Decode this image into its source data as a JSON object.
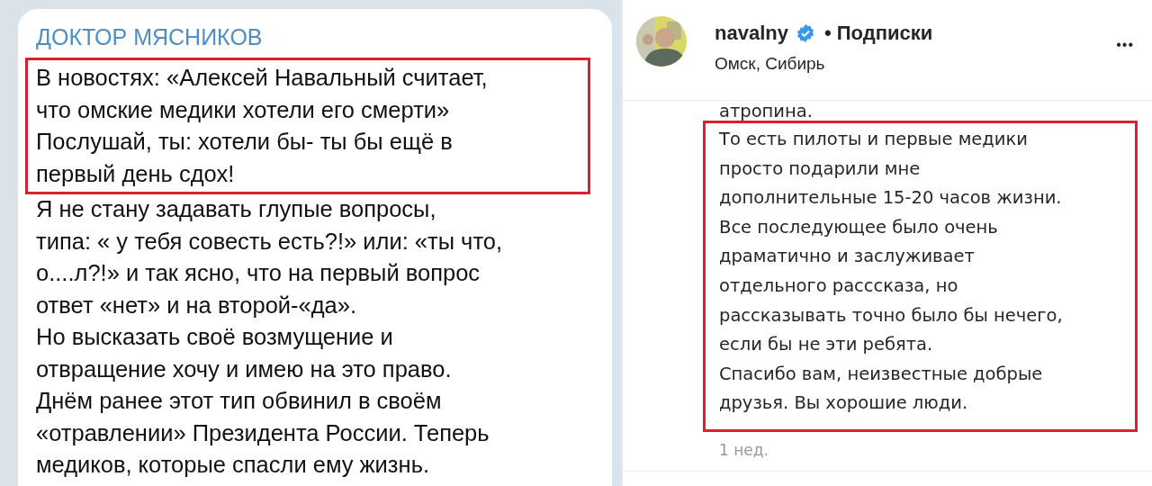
{
  "telegram_post": {
    "channel": "ДОКТОР МЯСНИКОВ",
    "highlighted_lines": [
      "В новостях: «Алексей Навальный считает,",
      "что омские медики хотели его смерти»",
      "Послушай, ты: хотели бы- ты бы ещё в",
      "первый день сдох!"
    ],
    "lines": [
      "Я не стану задавать глупые вопросы,",
      "типа: « у тебя совесть есть?!» или: «ты что,",
      "о....л?!» и так ясно, что на первый вопрос",
      "ответ «нет» и на второй-«да».",
      "Но высказать своё возмущение и",
      "отвращение хочу и имею на это право.",
      "Днём ранее этот тип обвинил в своём",
      "«отравлении» Президента России. Теперь",
      "медиков, которые спасли ему жизнь."
    ]
  },
  "instagram_post": {
    "username": "navalny",
    "verified": true,
    "follow_label": "• Подписки",
    "location": "Омск, Сибирь",
    "more": "•••",
    "lines": [
      "атропина."
    ],
    "highlighted_lines": [
      "То есть пилоты и первые медики",
      "просто подарили мне",
      "дополнительные 15-20 часов жизни.",
      "Все последующее было очень",
      "драматично и заслуживает",
      "отдельного расссказа, но",
      "рассказывать точно было бы нечего,",
      "если бы не эти ребята.",
      "Спасибо вам, неизвестные добрые",
      "друзья. Вы хорошие люди."
    ],
    "time": "1 нед."
  }
}
